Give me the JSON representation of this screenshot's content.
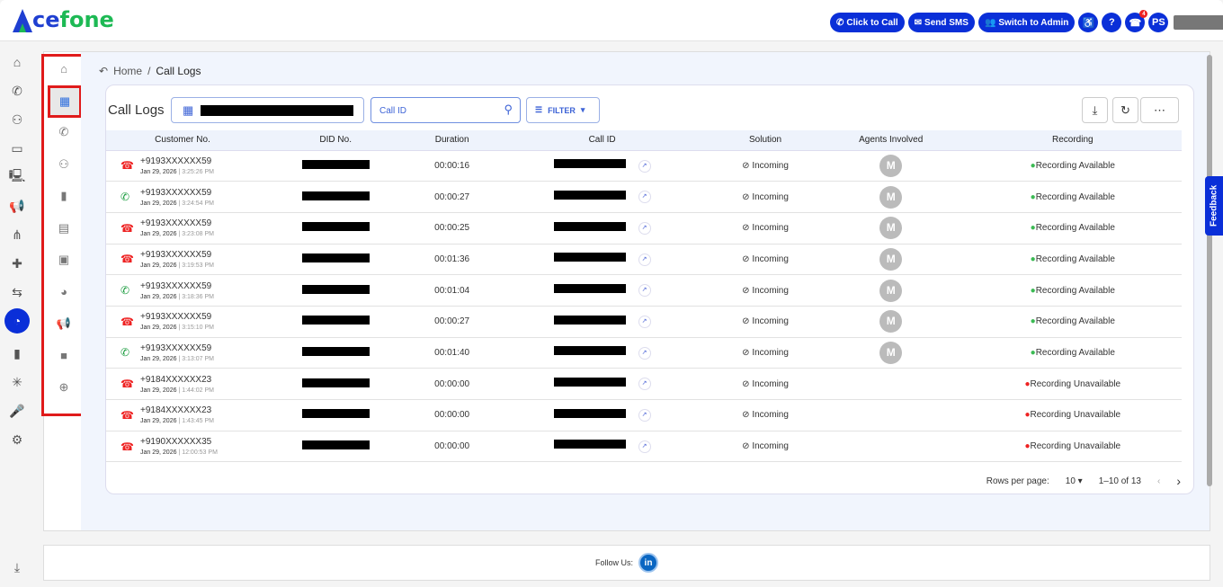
{
  "brand": {
    "logo": "Acefone",
    "colors": {
      "primary": "#0a2fd8",
      "green": "#1db954",
      "highlight": "#e01b1b"
    }
  },
  "header": {
    "click_to_call": "Click to Call",
    "send_sms": "Send SMS",
    "switch_admin": "Switch to Admin",
    "help": "?",
    "missed_badge": "4",
    "avatar": "PS"
  },
  "rail": [
    "home-icon",
    "phone-icon",
    "users-icon",
    "wallet-icon",
    "monitor-settings-icon",
    "megaphone-icon",
    "network-icon",
    "integrations-icon",
    "ivr-icon",
    "reports-pie-icon",
    "bar-chart-icon",
    "hub-icon",
    "mic-icon",
    "settings-icon",
    "download-icon"
  ],
  "subnav": [
    "home-icon",
    "call-logs-table-icon",
    "live-calls-icon",
    "agents-icon",
    "analytics-premium-icon",
    "sms-logs-icon",
    "report-icon",
    "campaign-report-icon",
    "broadcast-icon",
    "video-icon",
    "download-reports-icon"
  ],
  "breadcrumb": {
    "home": "Home",
    "sep": "/",
    "current": "Call Logs"
  },
  "page": {
    "title": "Call Logs",
    "search_placeholder": "Call ID",
    "filter": "FILTER"
  },
  "table": {
    "headers": [
      "Customer No.",
      "DID No.",
      "Duration",
      "Call ID",
      "Solution",
      "Agents Involved",
      "Recording"
    ],
    "rows": [
      {
        "type": "missed",
        "number": "+9193XXXXXX59",
        "date": "Jan 29, 2026",
        "time": "3:25:26 PM",
        "duration": "00:00:16",
        "solution": "Incoming",
        "agent": "M",
        "recording": "Recording Available",
        "rec_ok": true
      },
      {
        "type": "received",
        "number": "+9193XXXXXX59",
        "date": "Jan 29, 2026",
        "time": "3:24:54 PM",
        "duration": "00:00:27",
        "solution": "Incoming",
        "agent": "M",
        "recording": "Recording Available",
        "rec_ok": true
      },
      {
        "type": "missed",
        "number": "+9193XXXXXX59",
        "date": "Jan 29, 2026",
        "time": "3:23:08 PM",
        "duration": "00:00:25",
        "solution": "Incoming",
        "agent": "M",
        "recording": "Recording Available",
        "rec_ok": true
      },
      {
        "type": "missed",
        "number": "+9193XXXXXX59",
        "date": "Jan 29, 2026",
        "time": "3:19:53 PM",
        "duration": "00:01:36",
        "solution": "Incoming",
        "agent": "M",
        "recording": "Recording Available",
        "rec_ok": true
      },
      {
        "type": "received",
        "number": "+9193XXXXXX59",
        "date": "Jan 29, 2026",
        "time": "3:18:36 PM",
        "duration": "00:01:04",
        "solution": "Incoming",
        "agent": "M",
        "recording": "Recording Available",
        "rec_ok": true
      },
      {
        "type": "missed",
        "number": "+9193XXXXXX59",
        "date": "Jan 29, 2026",
        "time": "3:15:10 PM",
        "duration": "00:00:27",
        "solution": "Incoming",
        "agent": "M",
        "recording": "Recording Available",
        "rec_ok": true
      },
      {
        "type": "received",
        "number": "+9193XXXXXX59",
        "date": "Jan 29, 2026",
        "time": "3:13:07 PM",
        "duration": "00:01:40",
        "solution": "Incoming",
        "agent": "M",
        "recording": "Recording Available",
        "rec_ok": true
      },
      {
        "type": "missed",
        "number": "+9184XXXXXX23",
        "date": "Jan 29, 2026",
        "time": "1:44:02 PM",
        "duration": "00:00:00",
        "solution": "Incoming",
        "agent": "",
        "recording": "Recording Unavailable",
        "rec_ok": false
      },
      {
        "type": "missed",
        "number": "+9184XXXXXX23",
        "date": "Jan 29, 2026",
        "time": "1:43:45 PM",
        "duration": "00:00:00",
        "solution": "Incoming",
        "agent": "",
        "recording": "Recording Unavailable",
        "rec_ok": false
      },
      {
        "type": "missed",
        "number": "+9190XXXXXX35",
        "date": "Jan 29, 2026",
        "time": "12:00:53 PM",
        "duration": "00:00:00",
        "solution": "Incoming",
        "agent": "",
        "recording": "Recording Unavailable",
        "rec_ok": false
      }
    ]
  },
  "pagination": {
    "rows_label": "Rows per page:",
    "rows_value": "10",
    "range": "1–10 of 13"
  },
  "feedback": "Feedback",
  "footer": {
    "follow": "Follow Us:",
    "linkedin": "in"
  }
}
